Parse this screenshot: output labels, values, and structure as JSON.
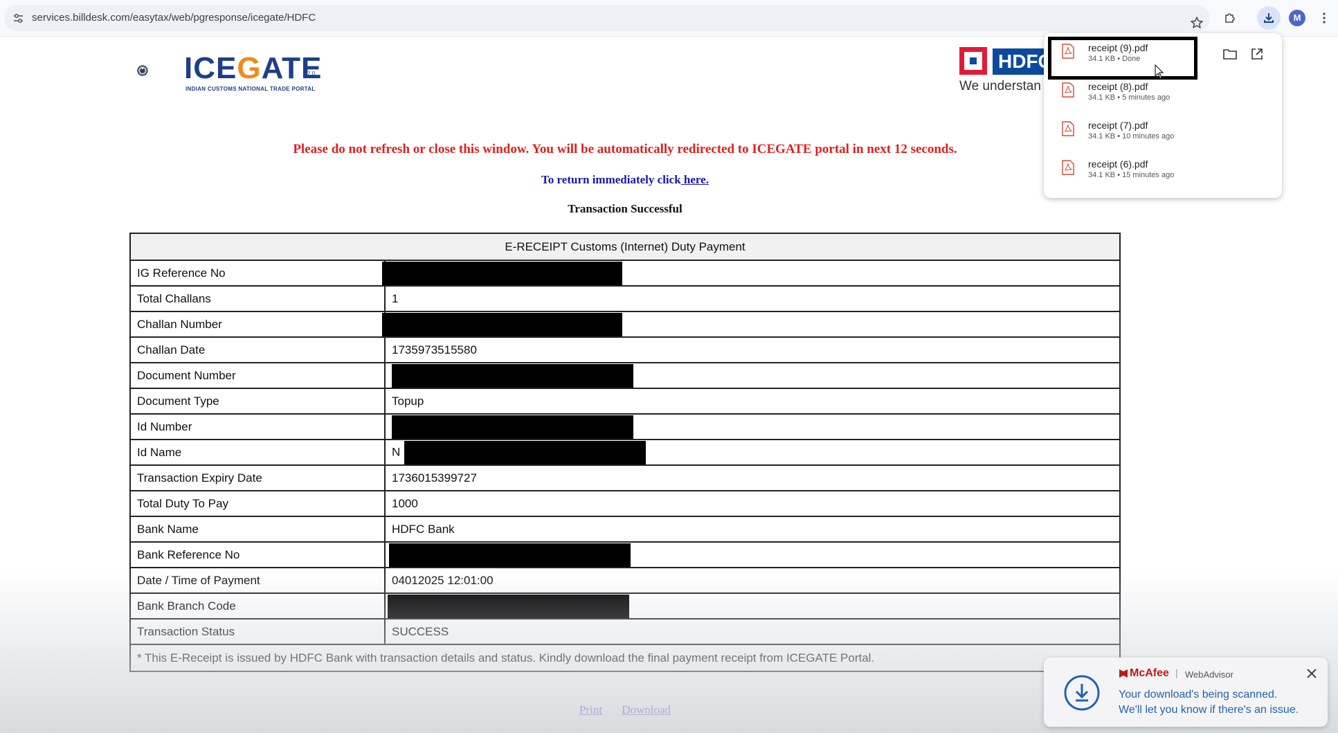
{
  "browser": {
    "url": "services.billdesk.com/easytax/web/pgresponse/icegate/HDFC",
    "profile_initial": "M"
  },
  "header": {
    "icegate_logo_text_1": "ICE",
    "icegate_logo_text_2": "G",
    "icegate_logo_text_3": "ATE",
    "icegate_version": "2.0",
    "icegate_tagline": "INDIAN CUSTOMS NATIONAL TRADE PORTAL",
    "hdfc_logo_text": "HDFC",
    "hdfc_tagline": "We understan"
  },
  "messages": {
    "redirect": "Please do not refresh or close this window. You will be automatically redirected to ICEGATE portal in next 12 seconds.",
    "return_prefix": "To return immediately click",
    "return_link": " here.",
    "transaction_status": "Transaction Successful"
  },
  "receipt": {
    "title": "E-RECEIPT Customs (Internet) Duty Payment",
    "rows": [
      {
        "label": "IG Reference No",
        "value": "",
        "redacted": true
      },
      {
        "label": "Total Challans",
        "value": "1",
        "redacted": false
      },
      {
        "label": "Challan Number",
        "value": "",
        "redacted": true
      },
      {
        "label": "Challan Date",
        "value": "1735973515580",
        "redacted": false
      },
      {
        "label": "Document Number",
        "value": "",
        "redacted": true
      },
      {
        "label": "Document Type",
        "value": "Topup",
        "redacted": false
      },
      {
        "label": "Id Number",
        "value": "",
        "redacted": true
      },
      {
        "label": "Id Name",
        "value": "N",
        "redacted": true
      },
      {
        "label": "Transaction Expiry Date",
        "value": "1736015399727",
        "redacted": false
      },
      {
        "label": "Total Duty To Pay",
        "value": "1000",
        "redacted": false
      },
      {
        "label": "Bank Name",
        "value": "HDFC Bank",
        "redacted": false
      },
      {
        "label": "Bank Reference No",
        "value": "",
        "redacted": true
      },
      {
        "label": "Date / Time of Payment",
        "value": "04012025 12:01:00",
        "redacted": false
      },
      {
        "label": "Bank Branch Code",
        "value": "",
        "redacted": true
      },
      {
        "label": "Transaction Status",
        "value": "SUCCESS",
        "redacted": false
      }
    ],
    "footnote": "* This E-Receipt is issued by HDFC Bank with transaction details and status. Kindly download the final payment receipt from ICEGATE Portal."
  },
  "footer": {
    "print_label": "Print",
    "download_label": "Download"
  },
  "downloads": {
    "items": [
      {
        "name": "receipt (9).pdf",
        "meta": "34.1 KB • Done"
      },
      {
        "name": "receipt (8).pdf",
        "meta": "34.1 KB • 5 minutes ago"
      },
      {
        "name": "receipt (7).pdf",
        "meta": "34.1 KB • 10 minutes ago"
      },
      {
        "name": "receipt (6).pdf",
        "meta": "34.1 KB • 15 minutes ago"
      }
    ]
  },
  "mcafee": {
    "brand": "McAfee",
    "separator": "|",
    "product": "WebAdvisor",
    "line1": "Your download's being scanned.",
    "line2": "We'll let you know if there's an issue."
  },
  "colors": {
    "alert_red": "#e0201d",
    "link_blue": "#1a14b3",
    "icegate_blue": "#1d3f8a",
    "icegate_orange": "#f08a1c",
    "hdfc_blue": "#0d4a9e",
    "mcafee_red": "#c01818"
  }
}
